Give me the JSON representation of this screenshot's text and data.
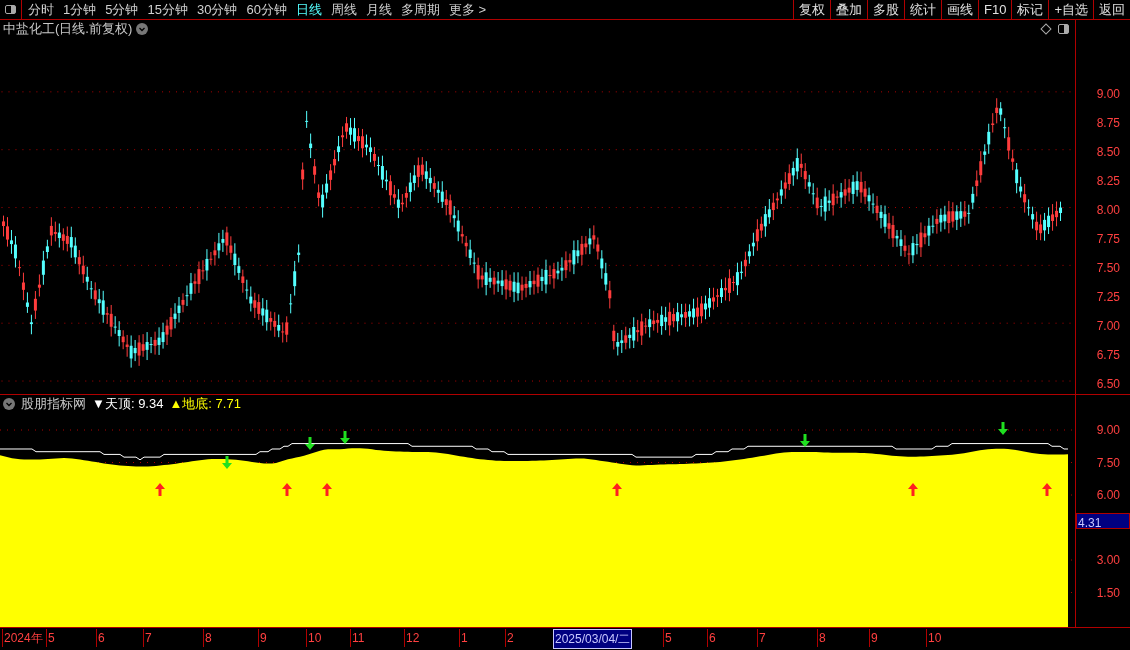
{
  "toolbar": {
    "periods": [
      {
        "label": "分时",
        "selected": false
      },
      {
        "label": "1分钟",
        "selected": false
      },
      {
        "label": "5分钟",
        "selected": false
      },
      {
        "label": "15分钟",
        "selected": false
      },
      {
        "label": "30分钟",
        "selected": false
      },
      {
        "label": "60分钟",
        "selected": false
      },
      {
        "label": "日线",
        "selected": true
      },
      {
        "label": "周线",
        "selected": false
      },
      {
        "label": "月线",
        "selected": false
      },
      {
        "label": "多周期",
        "selected": false
      },
      {
        "label": "更多 >",
        "selected": false
      }
    ],
    "actions": [
      "复权",
      "叠加",
      "多股",
      "统计",
      "画线",
      "F10",
      "标记",
      "+自选",
      "返回"
    ]
  },
  "main_panel": {
    "title": "中盐化工(日线.前复权)",
    "y_axis_labels": [
      "9.00",
      "8.75",
      "8.50",
      "8.25",
      "8.00",
      "7.75",
      "7.50",
      "7.25",
      "7.00",
      "6.75",
      "6.50"
    ]
  },
  "indicator_panel": {
    "name": "股朋指标网",
    "top": {
      "marker": "▼",
      "label": "天顶:",
      "value": "9.34"
    },
    "bottom": {
      "marker": "▲",
      "label": "地底:",
      "value": "7.71"
    },
    "y_axis_labels": [
      "9.00",
      "7.50",
      "6.00",
      "3.00",
      "1.50"
    ],
    "cursor_value": "4.31"
  },
  "time_axis": [
    {
      "label": "2024年",
      "selected": false
    },
    {
      "label": "5",
      "selected": false
    },
    {
      "label": "6",
      "selected": false
    },
    {
      "label": "7",
      "selected": false
    },
    {
      "label": "8",
      "selected": false
    },
    {
      "label": "9",
      "selected": false
    },
    {
      "label": "10",
      "selected": false
    },
    {
      "label": "11",
      "selected": false
    },
    {
      "label": "12",
      "selected": false
    },
    {
      "label": "1",
      "selected": false
    },
    {
      "label": "2",
      "selected": false
    },
    {
      "label": "2025/03/04/二",
      "selected": true
    },
    {
      "label": "5",
      "selected": false
    },
    {
      "label": "6",
      "selected": false
    },
    {
      "label": "7",
      "selected": false
    },
    {
      "label": "8",
      "selected": false
    },
    {
      "label": "9",
      "selected": false
    },
    {
      "label": "10",
      "selected": false
    }
  ]
}
